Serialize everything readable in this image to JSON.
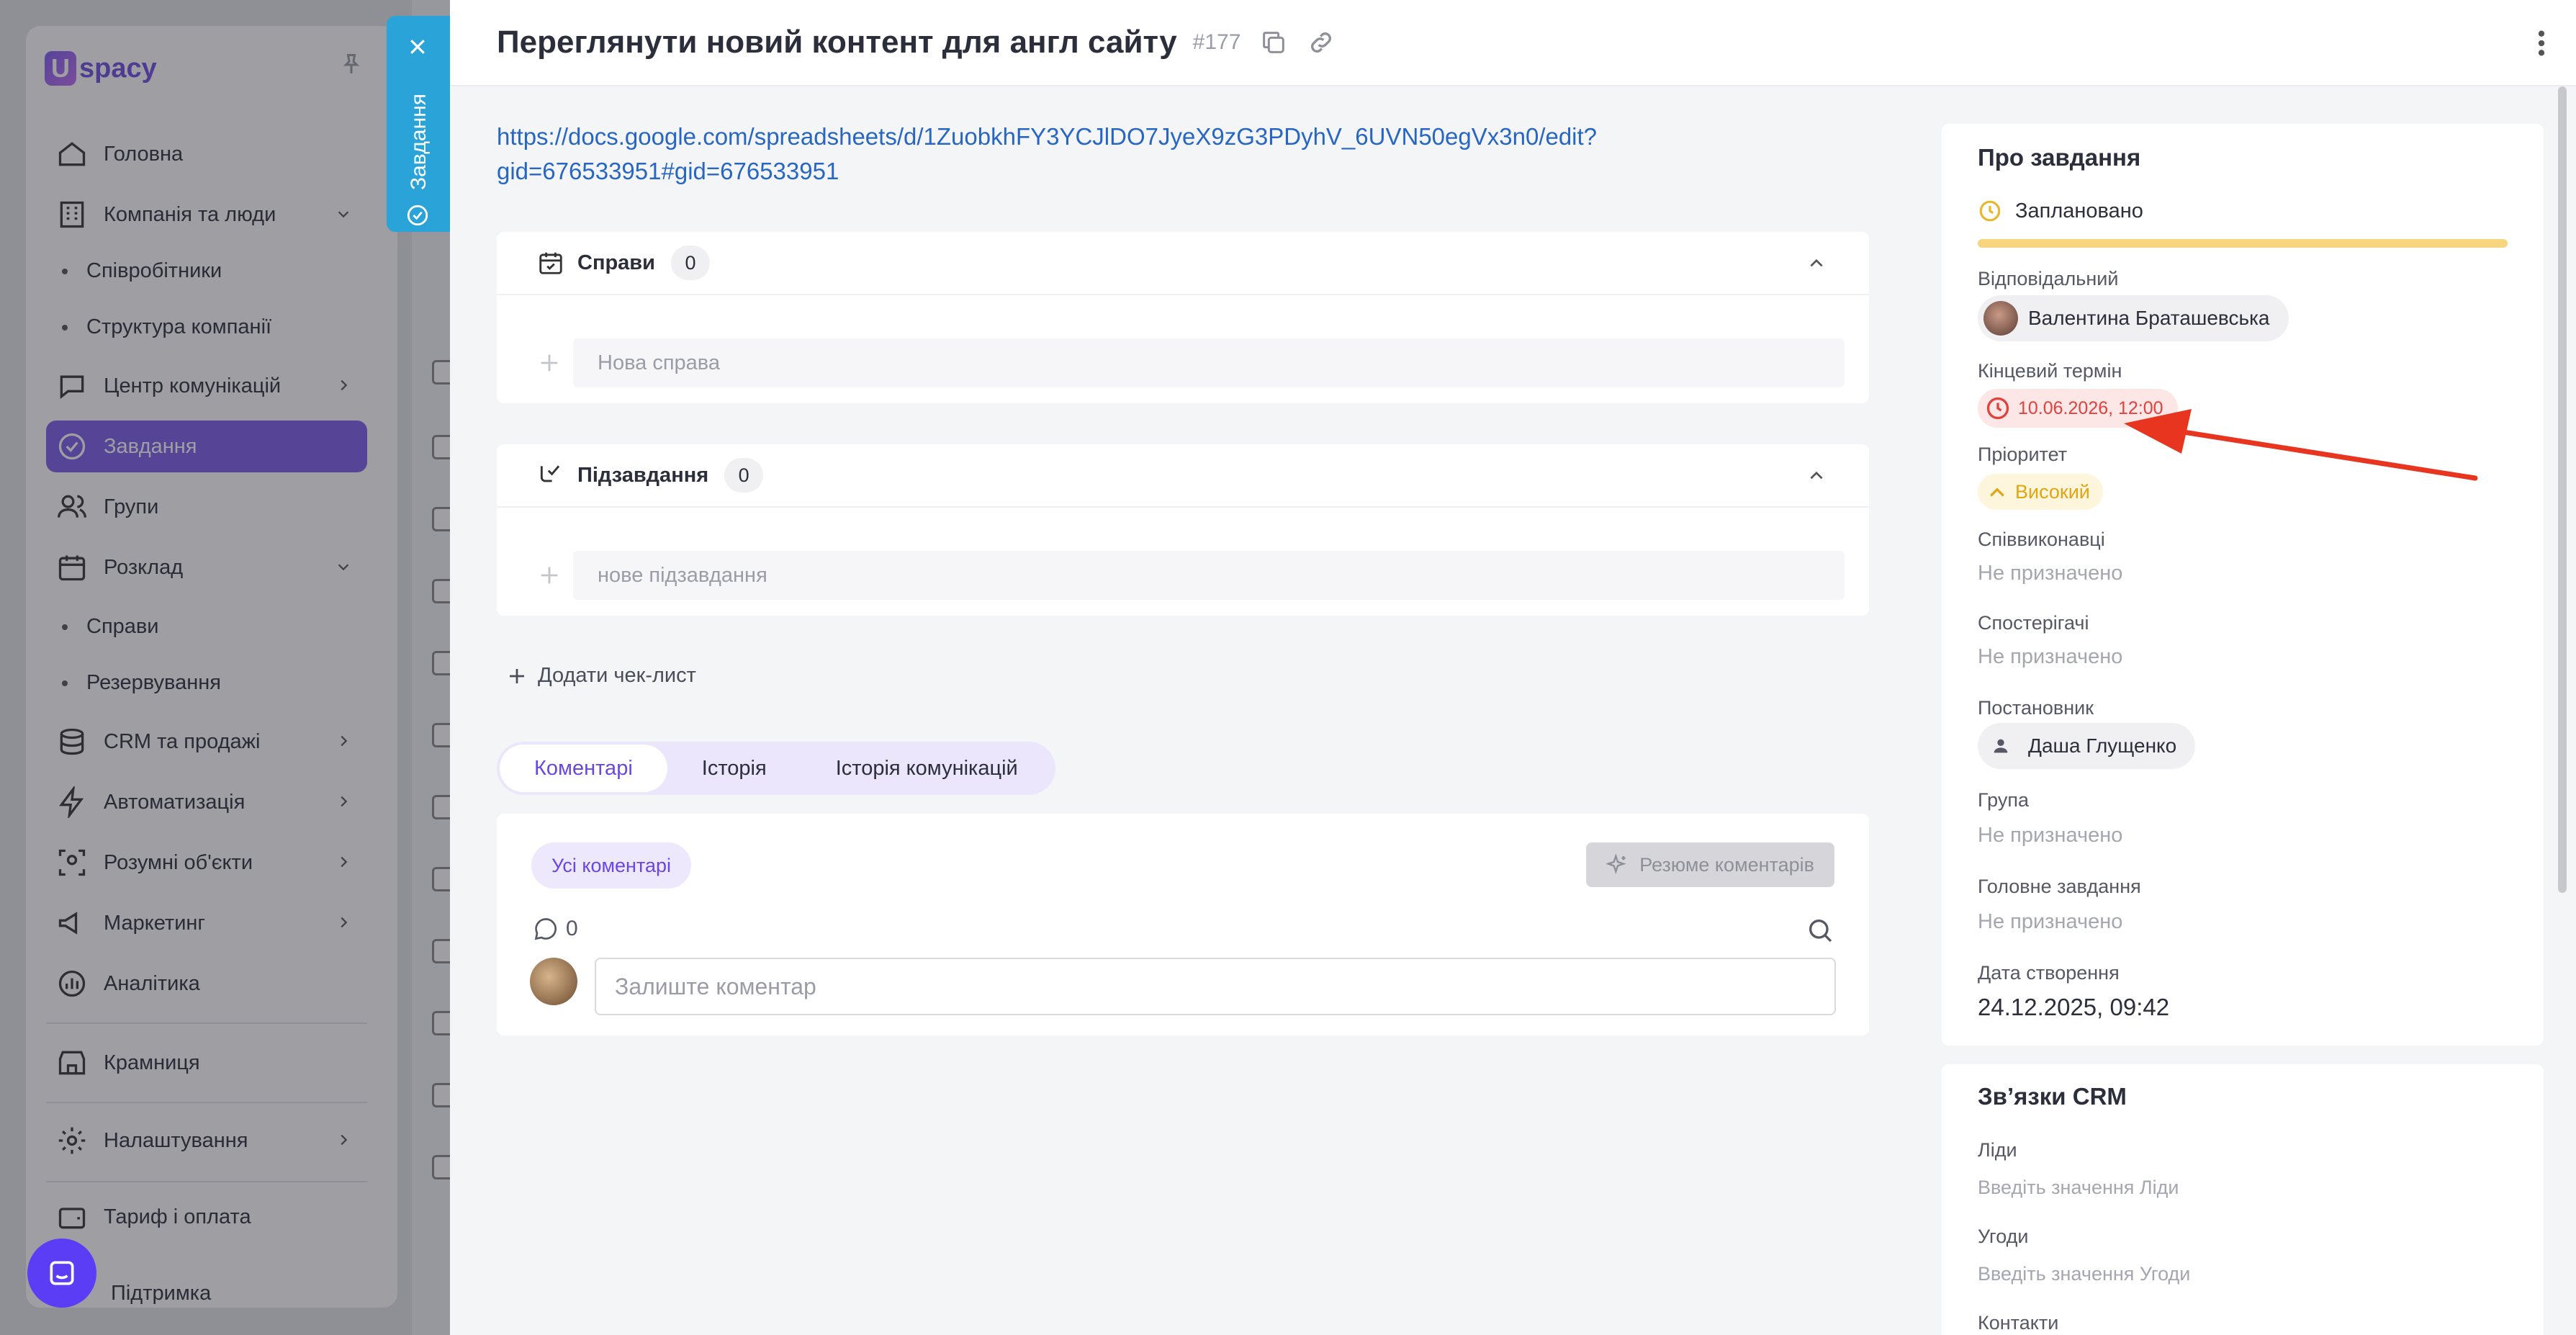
{
  "sidebar": {
    "logo_text": "spacy",
    "items": [
      {
        "label": "Головна"
      },
      {
        "label": "Компанія та люди"
      },
      {
        "label": "Співробітники"
      },
      {
        "label": "Структура компанії"
      },
      {
        "label": "Центр комунікацій"
      },
      {
        "label": "Завдання"
      },
      {
        "label": "Групи"
      },
      {
        "label": "Розклад"
      },
      {
        "label": "Справи"
      },
      {
        "label": "Резервування"
      },
      {
        "label": "CRM та продажі"
      },
      {
        "label": "Автоматизація"
      },
      {
        "label": "Розумні об'єкти"
      },
      {
        "label": "Маркетинг"
      },
      {
        "label": "Аналітика"
      },
      {
        "label": "Крамниця"
      },
      {
        "label": "Налаштування"
      },
      {
        "label": "Тариф і оплата"
      },
      {
        "label": "Підтримка"
      }
    ]
  },
  "vtab": {
    "label": "Завдання"
  },
  "task": {
    "title": "Переглянути новий контент для англ сайту",
    "number": "#177",
    "link": "https://docs.google.com/spreadsheets/d/1ZuobkhFY3YCJlDO7JyeX9zG3PDyhV_6UVN50egVx3n0/edit?gid=676533951#gid=676533951"
  },
  "todos": {
    "title": "Справи",
    "count": "0",
    "placeholder": "Нова справа"
  },
  "subtasks": {
    "title": "Підзавдання",
    "count": "0",
    "placeholder": "нове підзавдання"
  },
  "add_checklist": "Додати чек-лист",
  "tabs": [
    {
      "label": "Коментарі"
    },
    {
      "label": "Історія"
    },
    {
      "label": "Історія комунікацій"
    }
  ],
  "comments": {
    "filter_all": "Усі коментарі",
    "summary_button": "Резюме коментарів",
    "count": "0",
    "placeholder": "Залиште коментар"
  },
  "about": {
    "title": "Про завдання",
    "status": "Заплановано",
    "responsible_label": "Відповідальний",
    "responsible": "Валентина Браташевська",
    "deadline_label": "Кінцевий термін",
    "deadline": "10.06.2026, 12:00",
    "priority_label": "Пріоритет",
    "priority": "Високий",
    "coexecutors_label": "Співвиконавці",
    "coexecutors": "Не призначено",
    "observers_label": "Спостерігачі",
    "observers": "Не призначено",
    "creator_label": "Постановник",
    "creator": "Даша Глущенко",
    "group_label": "Група",
    "group": "Не призначено",
    "parent_label": "Головне завдання",
    "parent": "Не призначено",
    "created_label": "Дата створення",
    "created": "24.12.2025, 09:42"
  },
  "crm": {
    "title": "Зв’язки CRM",
    "leads_label": "Ліди",
    "leads_placeholder": "Введіть значення Ліди",
    "deals_label": "Угоди",
    "deals_placeholder": "Введіть значення Угоди",
    "contacts_label": "Контакти"
  },
  "colors": {
    "accent": "#7d5bea",
    "link": "#2866c4",
    "deadline": "#e0423e",
    "priority": "#e2a514",
    "status_bar": "#f7d47e",
    "annotation_arrow": "#e8351f"
  }
}
